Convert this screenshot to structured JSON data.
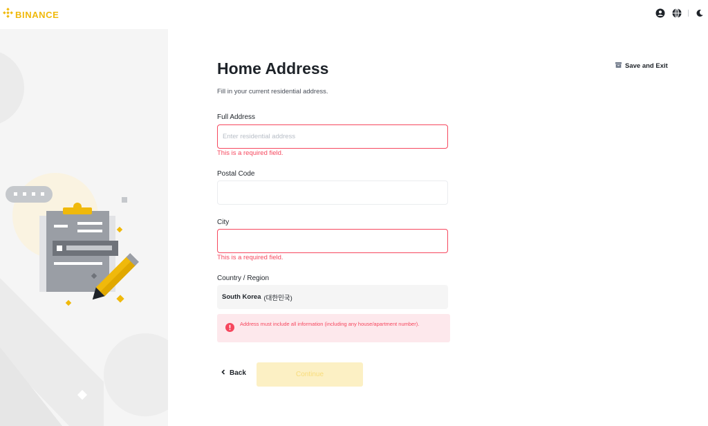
{
  "header": {
    "brand": "BINANCE",
    "icons": [
      "binance-logo-icon",
      "user-icon",
      "globe-icon",
      "moon-icon"
    ],
    "brand_color": "#f0b90b"
  },
  "save_exit": {
    "label": "Save and Exit",
    "icon": "archive-icon"
  },
  "form": {
    "title": "Home Address",
    "subtitle": "Fill in your current residential address.",
    "full_address": {
      "label": "Full Address",
      "placeholder": "Enter residential address",
      "value": "",
      "error": "This is a required field."
    },
    "postal_code": {
      "label": "Postal Code",
      "value": ""
    },
    "city": {
      "label": "City",
      "value": "",
      "error": "This is a required field."
    },
    "country": {
      "label": "Country / Region",
      "value_en": "South Korea",
      "value_native": "(대한민국)"
    },
    "alert": {
      "icon": "alert-circle-icon",
      "text": "Address must include all information (including any house/apartment number)."
    },
    "back_label": "Back",
    "continue_label": "Continue"
  },
  "colors": {
    "error": "#f6465d",
    "accent": "#f0b90b",
    "continue_disabled_bg": "#fcf0c4"
  }
}
